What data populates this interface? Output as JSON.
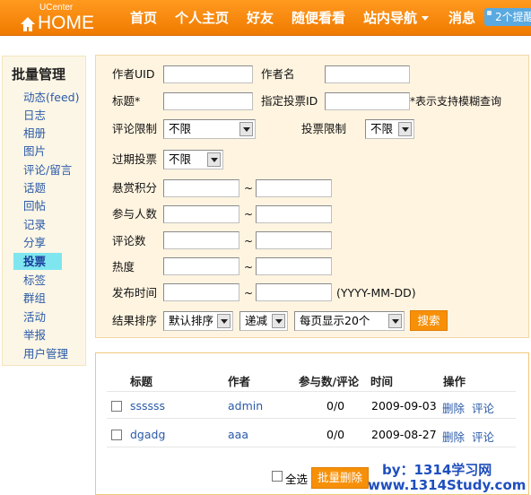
{
  "header": {
    "logo_small": "UCenter",
    "logo_main": "HOME",
    "nav": [
      "首页",
      "个人主页",
      "好友",
      "随便看看",
      "站内导航",
      "消息"
    ],
    "notice": "2个提醒"
  },
  "sidebar": {
    "title": "批量管理",
    "items": [
      "动态(feed)",
      "日志",
      "相册",
      "图片",
      "评论/留言",
      "话题",
      "回帖",
      "记录",
      "分享",
      "投票",
      "标签",
      "群组",
      "活动",
      "举报",
      "用户管理"
    ],
    "active_index": 9
  },
  "form": {
    "author_uid_label": "作者UID",
    "author_name_label": "作者名",
    "title_label": "标题*",
    "vote_id_label": "指定投票ID",
    "fuzzy_hint": "*表示支持模糊查询",
    "comment_limit_label": "评论限制",
    "comment_limit_value": "不限",
    "vote_limit_label": "投票限制",
    "vote_limit_value": "不限",
    "expired_label": "过期投票",
    "expired_value": "不限",
    "reward_label": "悬赏积分",
    "participants_label": "参与人数",
    "comments_label": "评论数",
    "heat_label": "热度",
    "publish_time_label": "发布时间",
    "range_sep": "~",
    "date_hint": "(YYYY-MM-DD)",
    "sort_label": "结果排序",
    "sort_value": "默认排序",
    "order_value": "递减",
    "page_size_value": "每页显示20个",
    "search_button": "搜索"
  },
  "table": {
    "headers": [
      "标题",
      "作者",
      "参与数/评论",
      "时间",
      "操作"
    ],
    "rows": [
      {
        "title": "ssssss",
        "author": "admin",
        "count": "0/0",
        "date": "2009-09-03",
        "delete": "删除",
        "comment": "评论"
      },
      {
        "title": "dgadg",
        "author": "aaa",
        "count": "0/0",
        "date": "2009-08-27",
        "delete": "删除",
        "comment": "评论"
      }
    ],
    "select_all": "全选",
    "batch_delete": "批量删除"
  },
  "watermark": {
    "line1": "by：1314学习网",
    "line2": "www.1314Study.com"
  }
}
